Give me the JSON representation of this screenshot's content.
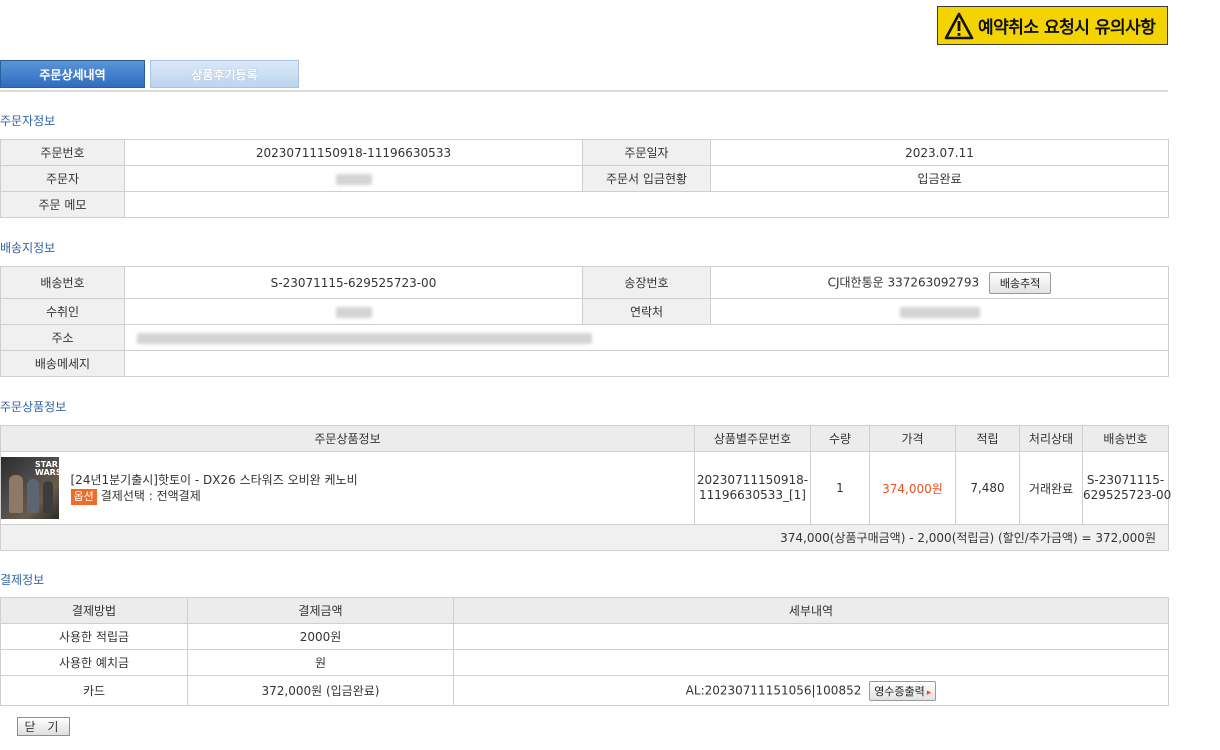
{
  "warning_banner": {
    "label": "예약취소 요청시 유의사항"
  },
  "tabs": [
    {
      "label": "주문상세내역",
      "active": true
    },
    {
      "label": "상품후기등록",
      "active": false
    }
  ],
  "orderer_section": {
    "title": "주문자정보",
    "order_number_label": "주문번호",
    "order_number": "20230711150918-11196630533",
    "order_date_label": "주문일자",
    "order_date": "2023.07.11",
    "orderer_label": "주문자",
    "payment_status_label": "주문서 입금현황",
    "payment_status": "입금완료",
    "memo_label": "주문 메모",
    "memo": ""
  },
  "shipping_section": {
    "title": "배송지정보",
    "shipping_number_label": "배송번호",
    "shipping_number": "S-23071115-629525723-00",
    "invoice_label": "송장번호",
    "invoice_value": "CJ대한통운 337263092793",
    "track_button": "배송추적",
    "recipient_label": "수취인",
    "contact_label": "연락처",
    "address_label": "주소",
    "message_label": "배송메세지",
    "message": ""
  },
  "products_section": {
    "title": "주문상품정보",
    "headers": [
      "주문상품정보",
      "상품별주문번호",
      "수량",
      "가격",
      "적립",
      "처리상태",
      "배송번호"
    ],
    "items": [
      {
        "name": "[24년1분기출시]핫토이 - DX26 스타워즈 오비완 케노비",
        "option_badge": "옵션",
        "option_text": "결제선택 : 전액결제",
        "thumb_logo": "STAR WARS",
        "item_order_number_line1": "20230711150918-",
        "item_order_number_line2": "11196630533_[1]",
        "quantity": "1",
        "price": "374,000원",
        "points": "7,480",
        "status": "거래완료",
        "shipping_number_line1": "S-23071115-",
        "shipping_number_line2": "629525723-00"
      }
    ],
    "summary": "374,000(상품구매금액) - 2,000(적립금) (할인/추가금액) = 372,000원"
  },
  "payment_section": {
    "title": "결제정보",
    "headers": [
      "결제방법",
      "결제금액",
      "세부내역"
    ],
    "rows": [
      {
        "method": "사용한 적립금",
        "amount": "2000원",
        "detail": ""
      },
      {
        "method": "사용한 예치금",
        "amount": "원",
        "detail": ""
      },
      {
        "method": "카드",
        "amount": "372,000원 (입금완료)",
        "detail": "AL:20230711151056|100852"
      }
    ],
    "receipt_button": "영수증출력"
  },
  "close_button": {
    "label": "닫 기"
  },
  "colors": {
    "accent_blue": "#2f64a8",
    "banner_yellow": "#f4d400",
    "price_orange": "#e8531e"
  }
}
